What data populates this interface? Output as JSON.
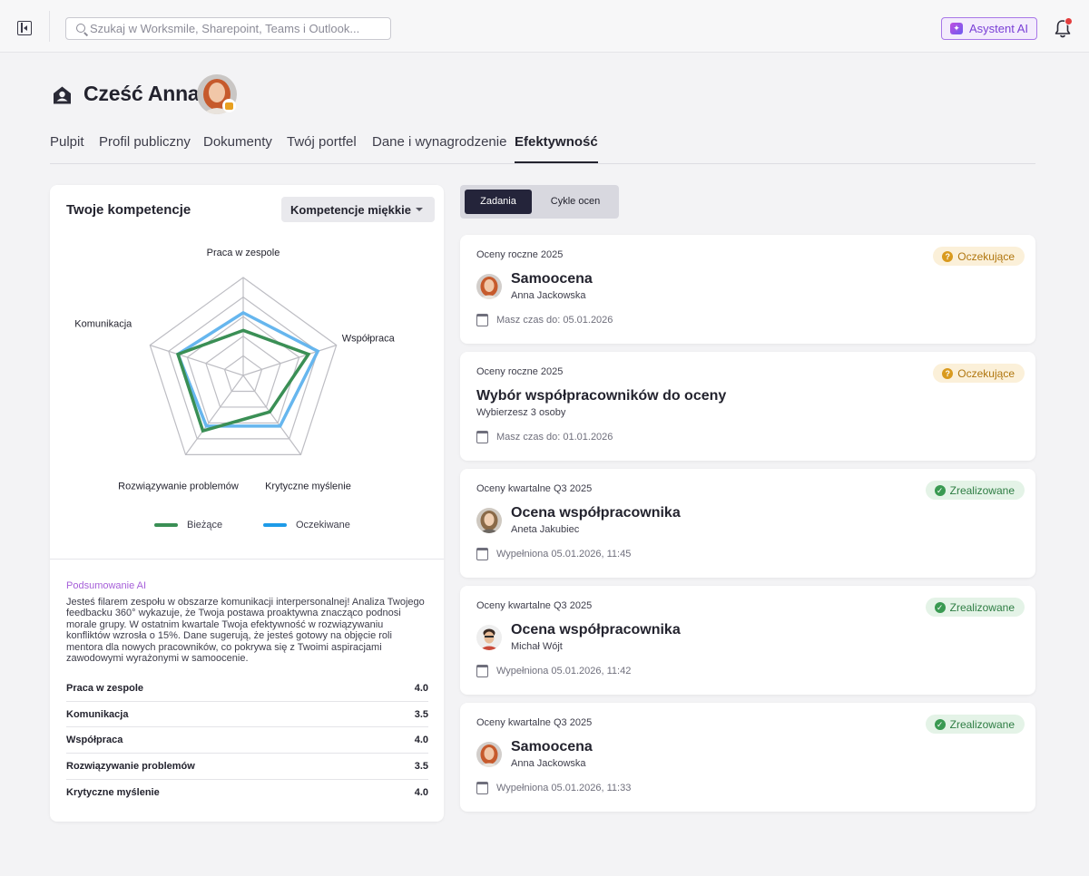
{
  "search": {
    "placeholder": "Szukaj w Worksmile, Sharepoint, Teams i Outlook..."
  },
  "assistant": {
    "label": "Asystent AI"
  },
  "header": {
    "greeting": "Cześć Anna"
  },
  "tabs": [
    {
      "label": "Pulpit"
    },
    {
      "label": "Profil publiczny"
    },
    {
      "label": "Dokumenty"
    },
    {
      "label": "Twój portfel"
    },
    {
      "label": "Dane i wynagrodzenie"
    },
    {
      "label": "Efektywność",
      "active": true
    }
  ],
  "competencies": {
    "title": "Twoje kompetencje",
    "selected_type": "Kompetencje miękkie",
    "axes": [
      "Praca w zespole",
      "Współpraca",
      "Krytyczne myślenie",
      "Rozwiązywanie problemów",
      "Komunikacja"
    ],
    "scale_max": 5,
    "series": [
      {
        "name": "Bieżące",
        "color": "#3a8f55",
        "values": [
          2.3,
          3.5,
          2.3,
          3.5,
          3.5
        ]
      },
      {
        "name": "Oczekiwane",
        "color": "#66b6ee",
        "values": [
          3.2,
          4.0,
          3.2,
          3.2,
          3.5
        ]
      }
    ],
    "ai_summary_label": "Podsumowanie AI",
    "ai_summary_text": "Jesteś filarem zespołu w obszarze komunikacji interpersonalnej! Analiza Twojego feedbacku 360° wykazuje, że Twoja postawa proaktywna znacząco podnosi morale grupy. W ostatnim kwartale Twoja efektywność w rozwiązywaniu konfliktów wzrosła o 15%. Dane sugerują, że jesteś gotowy na objęcie roli mentora dla nowych pracowników, co pokrywa się z Twoimi aspiracjami zawodowymi wyrażonymi w samoocenie.",
    "scores": [
      {
        "name": "Praca w zespole",
        "value": "4.0"
      },
      {
        "name": "Komunikacja",
        "value": "3.5"
      },
      {
        "name": "Współpraca",
        "value": "4.0"
      },
      {
        "name": "Rozwiązywanie problemów",
        "value": "3.5"
      },
      {
        "name": "Krytyczne myślenie",
        "value": "4.0"
      }
    ]
  },
  "segmented": {
    "active": "Zadania",
    "inactive": "Cykle ocen"
  },
  "tasks": [
    {
      "category": "Oceny roczne 2025",
      "status": "Oczekujące",
      "status_type": "pending",
      "title": "Samoocena",
      "subtitle": "Anna Jackowska",
      "date": "Masz czas do: 05.01.2026",
      "avatar": "anna"
    },
    {
      "category": "Oceny roczne 2025",
      "status": "Oczekujące",
      "status_type": "pending",
      "title": "Wybór współpracowników do oceny",
      "subtitle": "Wybierzesz 3 osoby",
      "date": "Masz czas do: 01.01.2026",
      "avatar": "none"
    },
    {
      "category": "Oceny kwartalne Q3 2025",
      "status": "Zrealizowane",
      "status_type": "done",
      "title": "Ocena współpracownika",
      "subtitle": "Aneta Jakubiec",
      "date": "Wypełniona 05.01.2026, 11:45",
      "avatar": "aneta"
    },
    {
      "category": "Oceny kwartalne Q3 2025",
      "status": "Zrealizowane",
      "status_type": "done",
      "title": "Ocena współpracownika",
      "subtitle": "Michał Wójt",
      "date": "Wypełniona 05.01.2026, 11:42",
      "avatar": "michal"
    },
    {
      "category": "Oceny kwartalne Q3 2025",
      "status": "Zrealizowane",
      "status_type": "done",
      "title": "Samoocena",
      "subtitle": "Anna Jackowska",
      "date": "Wypełniona 05.01.2026, 11:33",
      "avatar": "anna"
    }
  ]
}
